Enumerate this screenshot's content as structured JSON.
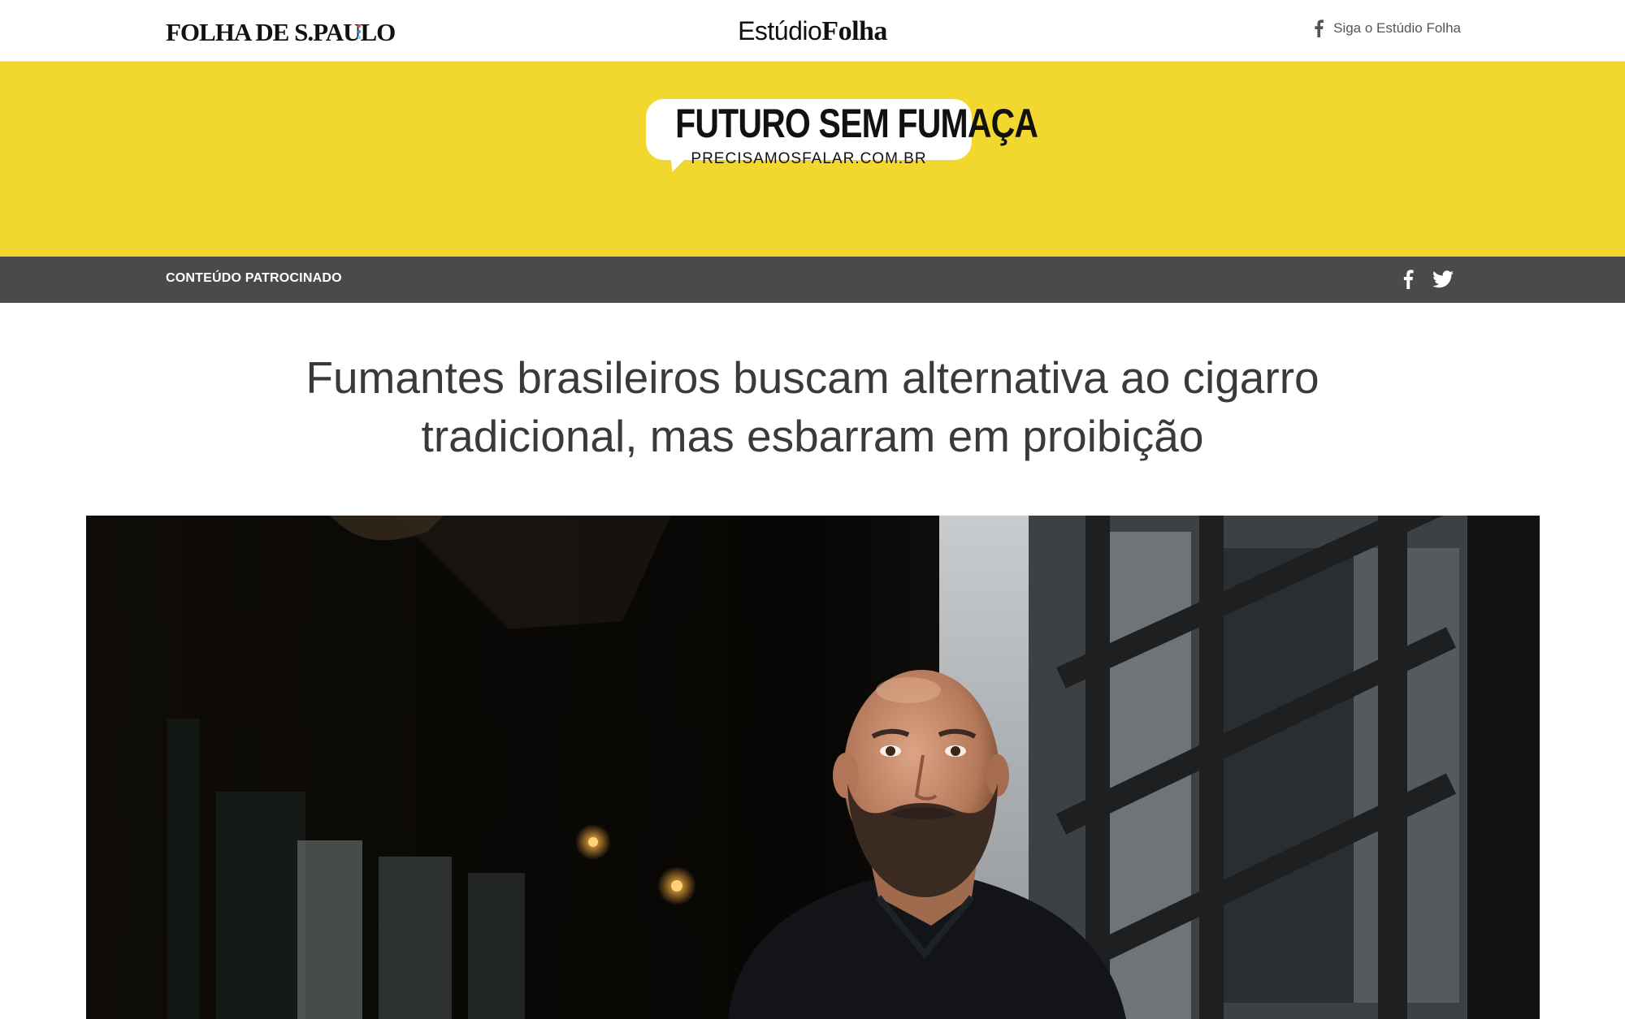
{
  "topbar": {
    "folha_logo": "FOLHA DE S.PAULO",
    "folha_dot_colors": [
      "#e84b5a",
      "#2f8fd1",
      "#7cc3ee"
    ],
    "estudio_light": "Estúdio",
    "estudio_bold": "Folha",
    "follow_label": "Siga o Estúdio Folha",
    "follow_icon": "facebook-icon"
  },
  "banner": {
    "background": "#f2d72f",
    "title": "FUTURO SEM FUMAÇA",
    "subtitle": "PRECISAMOSFALAR.COM.BR"
  },
  "sponsor_bar": {
    "label": "CONTEÚDO PATROCINADO",
    "share_icons": [
      "facebook-icon",
      "twitter-icon"
    ]
  },
  "article": {
    "headline": "Fumantes brasileiros buscam alternativa ao cigarro tradicional, mas esbarram em proibição"
  },
  "hero": {
    "subject": "bearded-man-portrait"
  }
}
